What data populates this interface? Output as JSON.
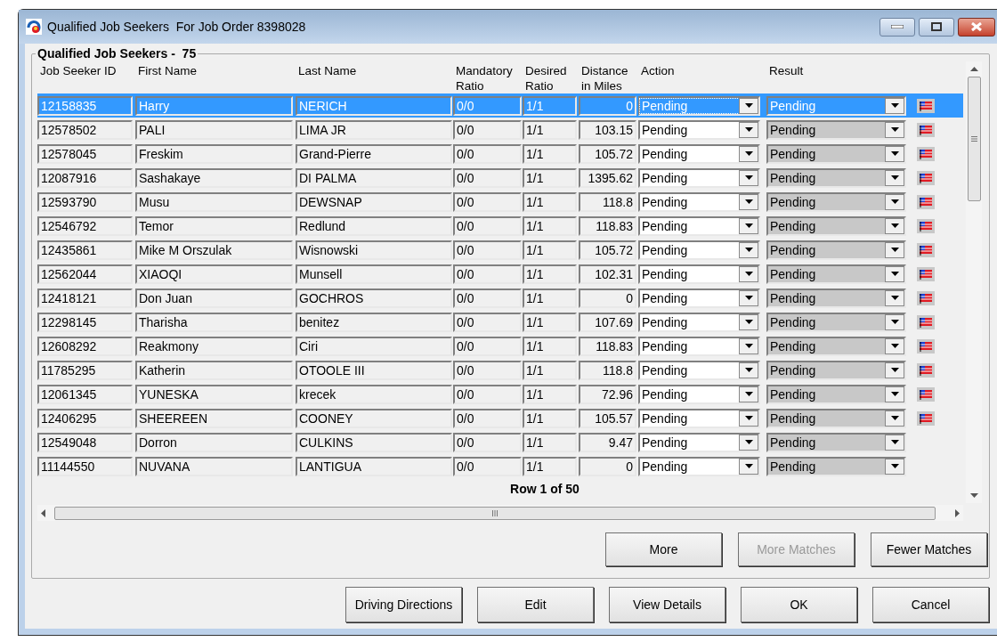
{
  "window": {
    "title": "Qualified Job Seekers  For Job Order 8398028"
  },
  "group": {
    "label": "Qualified Job Seekers -  75"
  },
  "table": {
    "columns": [
      "Job Seeker ID",
      "First Name",
      "Last Name",
      "Mandatory Ratio",
      "Desired Ratio",
      "Distance in Miles",
      "Action",
      "Result"
    ],
    "rows": [
      {
        "id": "12158835",
        "first": "Harry",
        "last": "NERICH",
        "mandatory": "0/0",
        "desired": "1/1",
        "distance": "0",
        "action": "Pending",
        "result": "Pending",
        "flagged": true,
        "selected": true
      },
      {
        "id": "12578502",
        "first": "PALI",
        "last": "LIMA JR",
        "mandatory": "0/0",
        "desired": "1/1",
        "distance": "103.15",
        "action": "Pending",
        "result": "Pending",
        "flagged": true,
        "selected": false
      },
      {
        "id": "12578045",
        "first": "Freskim",
        "last": "Grand-Pierre",
        "mandatory": "0/0",
        "desired": "1/1",
        "distance": "105.72",
        "action": "Pending",
        "result": "Pending",
        "flagged": true,
        "selected": false
      },
      {
        "id": "12087916",
        "first": "Sashakaye",
        "last": "DI PALMA",
        "mandatory": "0/0",
        "desired": "1/1",
        "distance": "1395.62",
        "action": "Pending",
        "result": "Pending",
        "flagged": true,
        "selected": false
      },
      {
        "id": "12593790",
        "first": "Musu",
        "last": "DEWSNAP",
        "mandatory": "0/0",
        "desired": "1/1",
        "distance": "118.8",
        "action": "Pending",
        "result": "Pending",
        "flagged": true,
        "selected": false
      },
      {
        "id": "12546792",
        "first": "Temor",
        "last": "Redlund",
        "mandatory": "0/0",
        "desired": "1/1",
        "distance": "118.83",
        "action": "Pending",
        "result": "Pending",
        "flagged": true,
        "selected": false
      },
      {
        "id": "12435861",
        "first": "Mike M Orszulak",
        "last": "Wisnowski",
        "mandatory": "0/0",
        "desired": "1/1",
        "distance": "105.72",
        "action": "Pending",
        "result": "Pending",
        "flagged": true,
        "selected": false
      },
      {
        "id": "12562044",
        "first": "XIAOQI",
        "last": "Munsell",
        "mandatory": "0/0",
        "desired": "1/1",
        "distance": "102.31",
        "action": "Pending",
        "result": "Pending",
        "flagged": true,
        "selected": false
      },
      {
        "id": "12418121",
        "first": "Don Juan",
        "last": "GOCHROS",
        "mandatory": "0/0",
        "desired": "1/1",
        "distance": "0",
        "action": "Pending",
        "result": "Pending",
        "flagged": true,
        "selected": false
      },
      {
        "id": "12298145",
        "first": "Tharisha",
        "last": "benitez",
        "mandatory": "0/0",
        "desired": "1/1",
        "distance": "107.69",
        "action": "Pending",
        "result": "Pending",
        "flagged": true,
        "selected": false
      },
      {
        "id": "12608292",
        "first": "Reakmony",
        "last": "Ciri",
        "mandatory": "0/0",
        "desired": "1/1",
        "distance": "118.83",
        "action": "Pending",
        "result": "Pending",
        "flagged": true,
        "selected": false
      },
      {
        "id": "11785295",
        "first": "Katherin",
        "last": "OTOOLE  III",
        "mandatory": "0/0",
        "desired": "1/1",
        "distance": "118.8",
        "action": "Pending",
        "result": "Pending",
        "flagged": true,
        "selected": false
      },
      {
        "id": "12061345",
        "first": "YUNESKA",
        "last": "krecek",
        "mandatory": "0/0",
        "desired": "1/1",
        "distance": "72.96",
        "action": "Pending",
        "result": "Pending",
        "flagged": true,
        "selected": false
      },
      {
        "id": "12406295",
        "first": "SHEEREEN",
        "last": "COONEY",
        "mandatory": "0/0",
        "desired": "1/1",
        "distance": "105.57",
        "action": "Pending",
        "result": "Pending",
        "flagged": true,
        "selected": false
      },
      {
        "id": "12549048",
        "first": "Dorron",
        "last": "CULKINS",
        "mandatory": "0/0",
        "desired": "1/1",
        "distance": "9.47",
        "action": "Pending",
        "result": "Pending",
        "flagged": false,
        "selected": false
      },
      {
        "id": "11144550",
        "first": "NUVANA",
        "last": "LANTIGUA",
        "mandatory": "0/0",
        "desired": "1/1",
        "distance": "0",
        "action": "Pending",
        "result": "Pending",
        "flagged": false,
        "selected": false
      }
    ]
  },
  "row_counter": "Row 1 of 50",
  "match_buttons": [
    {
      "label": "More",
      "disabled": false
    },
    {
      "label": "More Matches",
      "disabled": true
    },
    {
      "label": "Fewer Matches",
      "disabled": false
    }
  ],
  "buttons": [
    "Driving Directions",
    "Edit",
    "View Details",
    "OK",
    "Cancel"
  ]
}
